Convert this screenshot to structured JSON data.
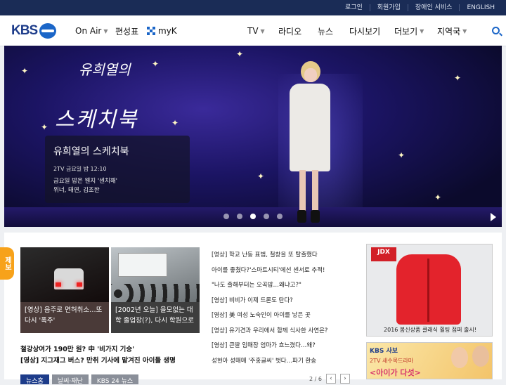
{
  "top_links": [
    "로그인",
    "회원가입",
    "장애인 서비스",
    "ENGLISH"
  ],
  "logo": {
    "text": "KBS"
  },
  "nav_left": {
    "onair": "On Air",
    "schedule": "편성표",
    "myk": "myK"
  },
  "nav_right": [
    "TV",
    "라디오",
    "뉴스",
    "다시보기",
    "더보기",
    "지역국"
  ],
  "hero": {
    "calligraphy_small": "유희열의",
    "calligraphy": "스케치북",
    "title": "유희열의 스케치북",
    "time": "2TV 금요일 밤 12:10",
    "desc": "금요일 밤은 웬지 '센치해'\n위너, 태연, 김조한",
    "slide_count": 5,
    "active_slide": 3
  },
  "report_tab": "제보",
  "thumbnails": [
    {
      "label": "[영상] 음주로 면허취소…또 다시 '폭주'"
    },
    {
      "label": "[2002년 오늘] 을모없는 대학 졸업장(?), 다시 학원으로"
    }
  ],
  "headlines": [
    "철강상여가 190만 원? 中 '비가지 기승'",
    "[영상] 지그재그 버스? 만취 기사에 맡겨진 아이들 생명"
  ],
  "tabs": [
    "뉴스홈",
    "날씨·재난",
    "KBS 24 뉴스"
  ],
  "news_list": [
    "[영상] 학교 난동 표범, 철창을 또 탈출했다",
    "아이를 좋쳤다?'스마트시티'에선 센서로 추적!",
    "\"나도 출해부터는 오곡밥…왜냐고?\"",
    "[영상] 비비가 이제 드론도 탄다?",
    "[영상] 美 여성 노숙인이 아이를 낳은 곳",
    "[영상] 유기견과 우리에서 함께 식사한 사연은?",
    "[영상] 큰딸 임매장 엄마가 흐느꼈다…왜?",
    "성현아 성매매 '주홍글씨' 벗다…파기 환송"
  ],
  "pager": {
    "label": "2 / 6"
  },
  "ads": {
    "jacket_brand": "JDX",
    "jacket_text": "2016 봄신상품 클래식 휠팅 점퍼 출시!",
    "kbs_brand": "KBS 사보",
    "kbs_sub": "2TV 새수목드라마",
    "kbs_title": "<아이가 다섯>"
  }
}
